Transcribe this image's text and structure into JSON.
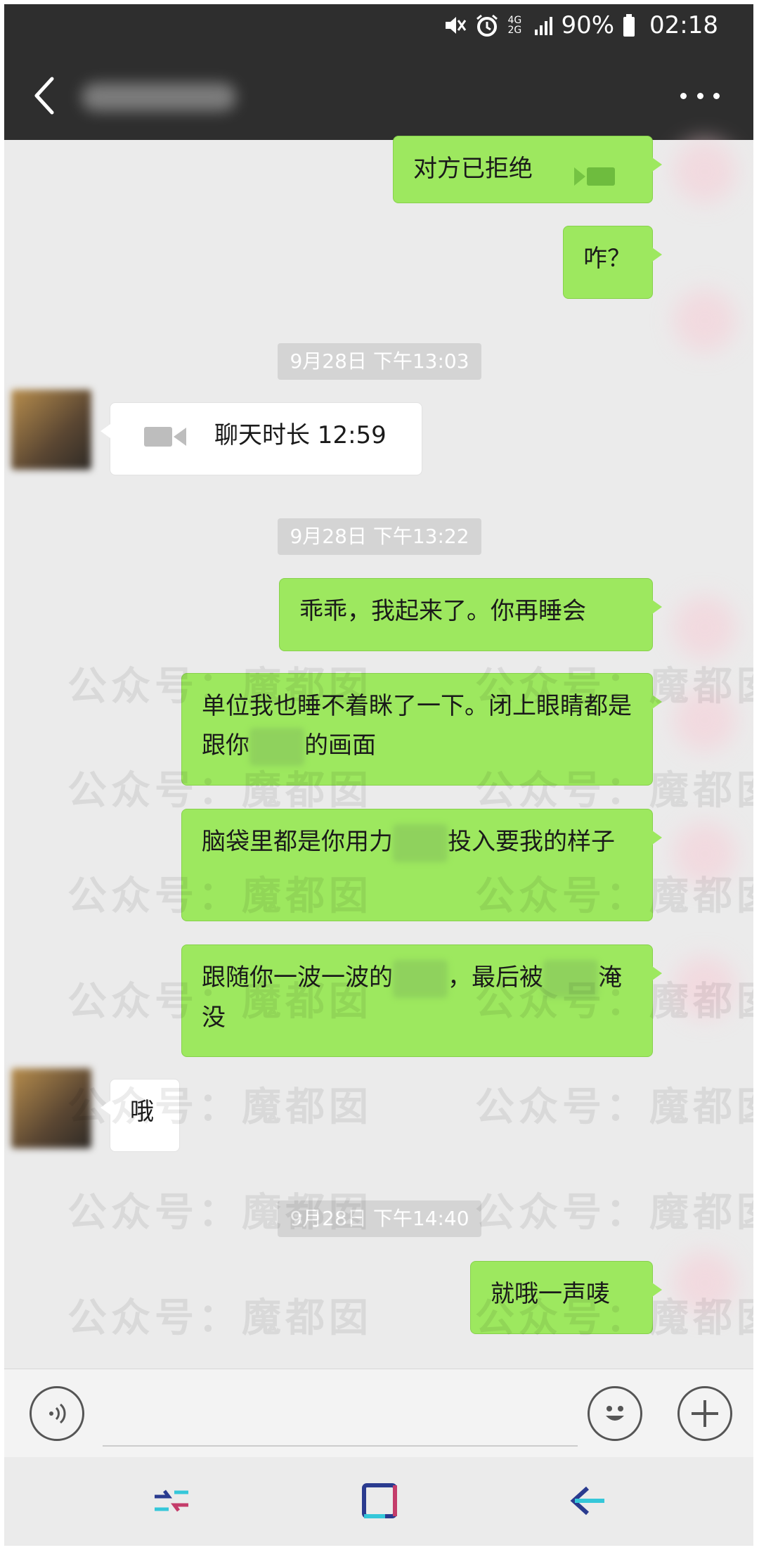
{
  "status": {
    "network": "4G 2G",
    "battery": "90%",
    "time": "02:18"
  },
  "header": {
    "title": ""
  },
  "messages": [
    {
      "side": "right",
      "text": "对方已拒绝"
    },
    {
      "side": "right",
      "text": "咋？"
    },
    {
      "timestamp": "9月28日 下午13:03"
    },
    {
      "side": "left",
      "text": "聊天时长 12:59"
    },
    {
      "timestamp": "9月28日 下午13:22"
    },
    {
      "side": "right",
      "text": "乖乖，我起来了。你再睡会"
    },
    {
      "side": "right",
      "parts": [
        "单位我也睡不着眯了一下。闭上眼睛都是跟你",
        "的画面"
      ]
    },
    {
      "side": "right",
      "parts": [
        "脑袋里都是你用力",
        "投入要我的样子"
      ]
    },
    {
      "side": "right",
      "parts": [
        "跟随你一波一波的",
        "，最后被",
        "淹没"
      ]
    },
    {
      "side": "left",
      "text": "哦"
    },
    {
      "timestamp": "9月28日 下午14:40"
    },
    {
      "side": "right",
      "text": "就哦一声唛"
    }
  ],
  "watermark": "公众号：魔都囡",
  "colors": {
    "sent_bubble": "#9de85f",
    "received_bubble": "#ffffff",
    "bar": "#2e2e2e",
    "background": "#ebebeb"
  }
}
